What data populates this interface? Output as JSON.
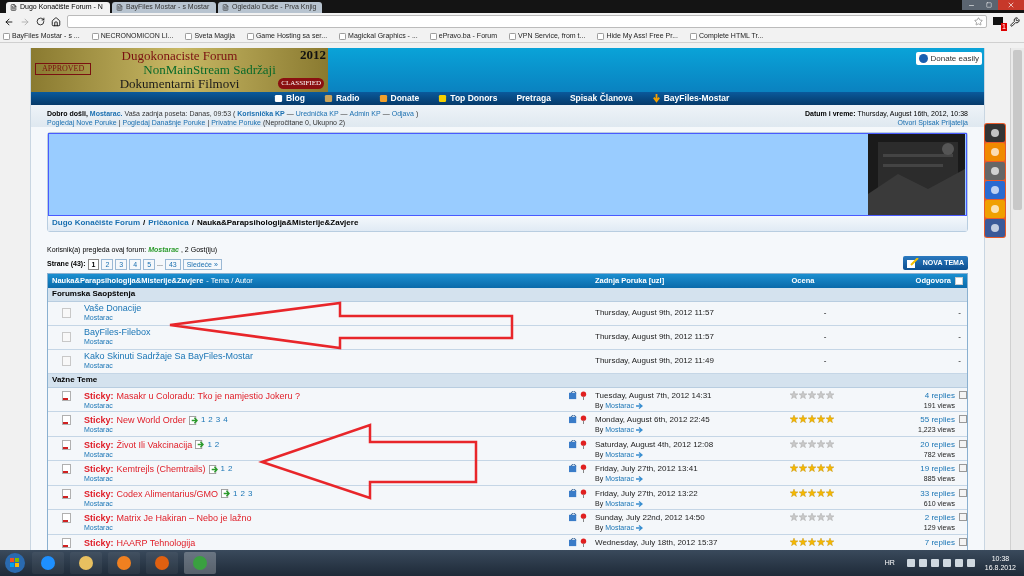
{
  "browser": {
    "tabs": [
      {
        "title": "Dugo Konačište Forum - N",
        "selected": true
      },
      {
        "title": "BayFiles Mostar - s Mostar",
        "selected": false
      },
      {
        "title": "Ogledalo Duše - Prva Knjig",
        "selected": false
      }
    ],
    "bookmarks": [
      "BayFiles Mostar - s ...",
      "NECRONOMICON LI...",
      "Sveta Magija",
      "Game Hosting sa ser...",
      "Magickal Graphics - ...",
      "ePravo.ba - Forum",
      "VPN Service, from t...",
      "Hide My Ass! Free Pr...",
      "Complete HTML Tr..."
    ],
    "extension_badge": "1"
  },
  "header": {
    "logo_lines": [
      "Dugokonaciste Forum",
      "NonMainStream Sadržaji",
      "Dokumentarni Filmovi"
    ],
    "logo_year": "2012",
    "logo_stamp": "APPROVED",
    "logo_seal": "CLASSIFIED",
    "donate": "Donate easily"
  },
  "nav": [
    {
      "label": "Blog"
    },
    {
      "label": "Radio"
    },
    {
      "label": "Donate"
    },
    {
      "label": "Top Donors"
    },
    {
      "label": "Pretraga"
    },
    {
      "label": "Spisak Članova"
    },
    {
      "label": "BayFiles-Mostar"
    }
  ],
  "userbar": {
    "line1": [
      {
        "kind": "bold",
        "text": "Dobro došli,"
      },
      {
        "kind": "boldlink",
        "text": "Mostarac."
      },
      {
        "kind": "plain",
        "text": "Vaša zadnja poseta: Danas, 09:53 ("
      },
      {
        "kind": "boldlink",
        "text": "Korisnička KP"
      },
      {
        "kind": "plain",
        "text": "—"
      },
      {
        "kind": "link",
        "text": "Urednička KP"
      },
      {
        "kind": "plain",
        "text": "—"
      },
      {
        "kind": "link",
        "text": "Admin KP"
      },
      {
        "kind": "plain",
        "text": "—"
      },
      {
        "kind": "link",
        "text": "Odjava"
      },
      {
        "kind": "plain",
        "text": ")"
      }
    ],
    "line2": [
      {
        "kind": "link",
        "text": "Pogledaj Nove Poruke"
      },
      {
        "kind": "plain",
        "text": "|"
      },
      {
        "kind": "link",
        "text": "Pogledaj Današnje Poruke"
      },
      {
        "kind": "plain",
        "text": "|"
      },
      {
        "kind": "link",
        "text": "Privatne Poruke"
      },
      {
        "kind": "plain",
        "text": "(Nepročitane 0, Ukupno 2)"
      }
    ],
    "date_label": "Datum i vreme:",
    "date": "Thursday, August 16th, 2012, 10:38",
    "friends": "Otvori Spisak Prijatelja"
  },
  "breadcrumb": {
    "items": [
      "Dugo Konačište Forum",
      "Pričaonica",
      "Nauka&Parapsihologija&Misterije&Zavjere"
    ],
    "separator": "/"
  },
  "viewers": {
    "label": "Korisnik(a) pregleda ovaj forum:",
    "user": "Mostarac",
    "guests": ", 2 Gost(iju)"
  },
  "pages": {
    "label": "Strane (43):",
    "items": [
      {
        "label": "1",
        "selected": true
      },
      {
        "label": "2",
        "selected": false
      },
      {
        "label": "3",
        "selected": false
      },
      {
        "label": "4",
        "selected": false
      },
      {
        "label": "5",
        "selected": false
      }
    ],
    "ellipsis": "...",
    "last": "43",
    "next": "Sledeće »"
  },
  "new_topic": "NOVA TEMA",
  "table": {
    "columns": {
      "forum": "Nauka&Parapsihologija&Misterije&Zavjere",
      "topic": "- Tema / Autor",
      "last_post": "Zadnja Poruka [uzl]",
      "rating": "Ocena",
      "replies": "Odgovora"
    },
    "select_all_checked": false,
    "sections": [
      {
        "title": "Forumska Saopštenja",
        "topics": [
          {
            "kind": "announcement",
            "title": "Vaše Donacije",
            "author": "Mostarac",
            "last_post": "Thursday, August 9th, 2012 11:57",
            "rating": "-",
            "replies": "-"
          },
          {
            "kind": "announcement",
            "title": "BayFiles-Filebox",
            "author": "Mostarac",
            "last_post": "Thursday, August 9th, 2012 11:57",
            "rating": "-",
            "replies": "-"
          },
          {
            "kind": "announcement",
            "title": "Kako Skinuti Sadržaje Sa BayFiles-Mostar",
            "author": "Mostarac",
            "last_post": "Thursday, August 9th, 2012 11:49",
            "rating": "-",
            "replies": "-"
          }
        ]
      },
      {
        "title": "Važne Teme",
        "topics": [
          {
            "kind": "sticky",
            "prefix": "Sticky:",
            "title": "Masakr u Coloradu: Tko je namjestio Jokeru ?",
            "author": "Mostarac",
            "last_date": "Tuesday, August 7th, 2012 14:31",
            "by": "By",
            "last_user": "Mostarac",
            "stars": 0,
            "replies": "4 replies",
            "views": "191 views",
            "checked": false
          },
          {
            "kind": "sticky",
            "prefix": "Sticky:",
            "title": "New World Order",
            "pages": [
              "1",
              "2",
              "3",
              "4"
            ],
            "author": "Mostarac",
            "last_date": "Monday, August 6th, 2012 22:45",
            "by": "By",
            "last_user": "Mostarac",
            "stars": 5,
            "replies": "55 replies",
            "views": "1,223 views",
            "checked": false
          },
          {
            "kind": "sticky",
            "prefix": "Sticky:",
            "title": "Život Ili Vakcinacija",
            "pages": [
              "1",
              "2"
            ],
            "author": "Mostarac",
            "last_date": "Saturday, August 4th, 2012 12:08",
            "by": "By",
            "last_user": "Mostarac",
            "stars": 0,
            "replies": "20 replies",
            "views": "782 views",
            "checked": false
          },
          {
            "kind": "sticky",
            "prefix": "Sticky:",
            "title": "Kemtrejls (Chemtrails)",
            "pages": [
              "1",
              "2"
            ],
            "author": "Mostarac",
            "last_date": "Friday, July 27th, 2012 13:41",
            "by": "By",
            "last_user": "Mostarac",
            "stars": 5,
            "replies": "19 replies",
            "views": "885 views",
            "checked": false
          },
          {
            "kind": "sticky",
            "prefix": "Sticky:",
            "title": "Codex Alimentarius/GMO",
            "pages": [
              "1",
              "2",
              "3"
            ],
            "author": "Mostarac",
            "last_date": "Friday, July 27th, 2012 13:22",
            "by": "By",
            "last_user": "Mostarac",
            "stars": 5,
            "replies": "33 replies",
            "views": "610 views",
            "checked": false
          },
          {
            "kind": "sticky",
            "prefix": "Sticky:",
            "title": "Matrix Je Hakiran – Nebo je lažno",
            "author": "Mostarac",
            "last_date": "Sunday, July 22nd, 2012 14:50",
            "by": "By",
            "last_user": "Mostarac",
            "stars": 0,
            "replies": "2 replies",
            "views": "129 views",
            "checked": false
          },
          {
            "kind": "sticky",
            "prefix": "Sticky:",
            "title": "HAARP Tehnologija",
            "last_date": "Wednesday, July 18th, 2012 15:37",
            "stars": 5,
            "replies": "7 replies",
            "checked": false
          }
        ]
      }
    ]
  },
  "taskbar": {
    "language": "HR",
    "time": "10:38",
    "date": "16.8.2012"
  }
}
